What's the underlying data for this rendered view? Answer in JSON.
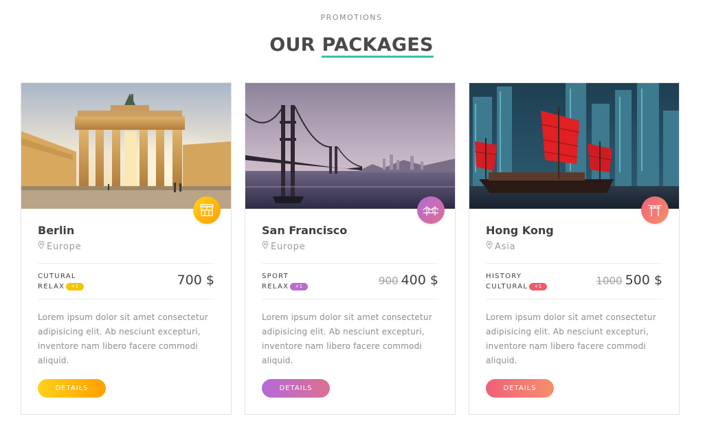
{
  "header": {
    "eyebrow": "PROMOTIONS",
    "title_part1": "OUR",
    "title_part2": "PACKAGES"
  },
  "accent_color": "#33c3b0",
  "cards": [
    {
      "city": "Berlin",
      "region": "Europe",
      "tag1": "CUTURAL",
      "tag2": "RELAX",
      "pill": "+1",
      "old_price": "",
      "price": "700 $",
      "desc": "Lorem ipsum dolor sit amet consectetur adipisicing elit. Ab nesciunt excepturi, inventore nam libero facere commodi aliquid.",
      "button": "DETAILS",
      "icon": "gate-icon",
      "color_from": "#ffd11a",
      "color_to": "#ff9f00"
    },
    {
      "city": "San Francisco",
      "region": "Europe",
      "tag1": "SPORT",
      "tag2": "RELAX",
      "pill": "+1",
      "old_price": "900",
      "price": "400 $",
      "desc": "Lorem ipsum dolor sit amet consectetur adipisicing elit. Ab nesciunt excepturi, inventore nam libero facere commodi aliquid.",
      "button": "DETAILS",
      "icon": "bridge-icon",
      "color_from": "#b36ad6",
      "color_to": "#de6f93"
    },
    {
      "city": "Hong Kong",
      "region": "Asia",
      "tag1": "HISTORY",
      "tag2": "CULTURAL",
      "pill": "+1",
      "old_price": "1000",
      "price": "500 $",
      "desc": "Lorem ipsum dolor sit amet consectetur adipisicing elit. Ab nesciunt excepturi, inventore nam libero facere commodi aliquid.",
      "button": "DETAILS",
      "icon": "torii-gate-icon",
      "color_from": "#f0607a",
      "color_to": "#f5906a"
    }
  ]
}
